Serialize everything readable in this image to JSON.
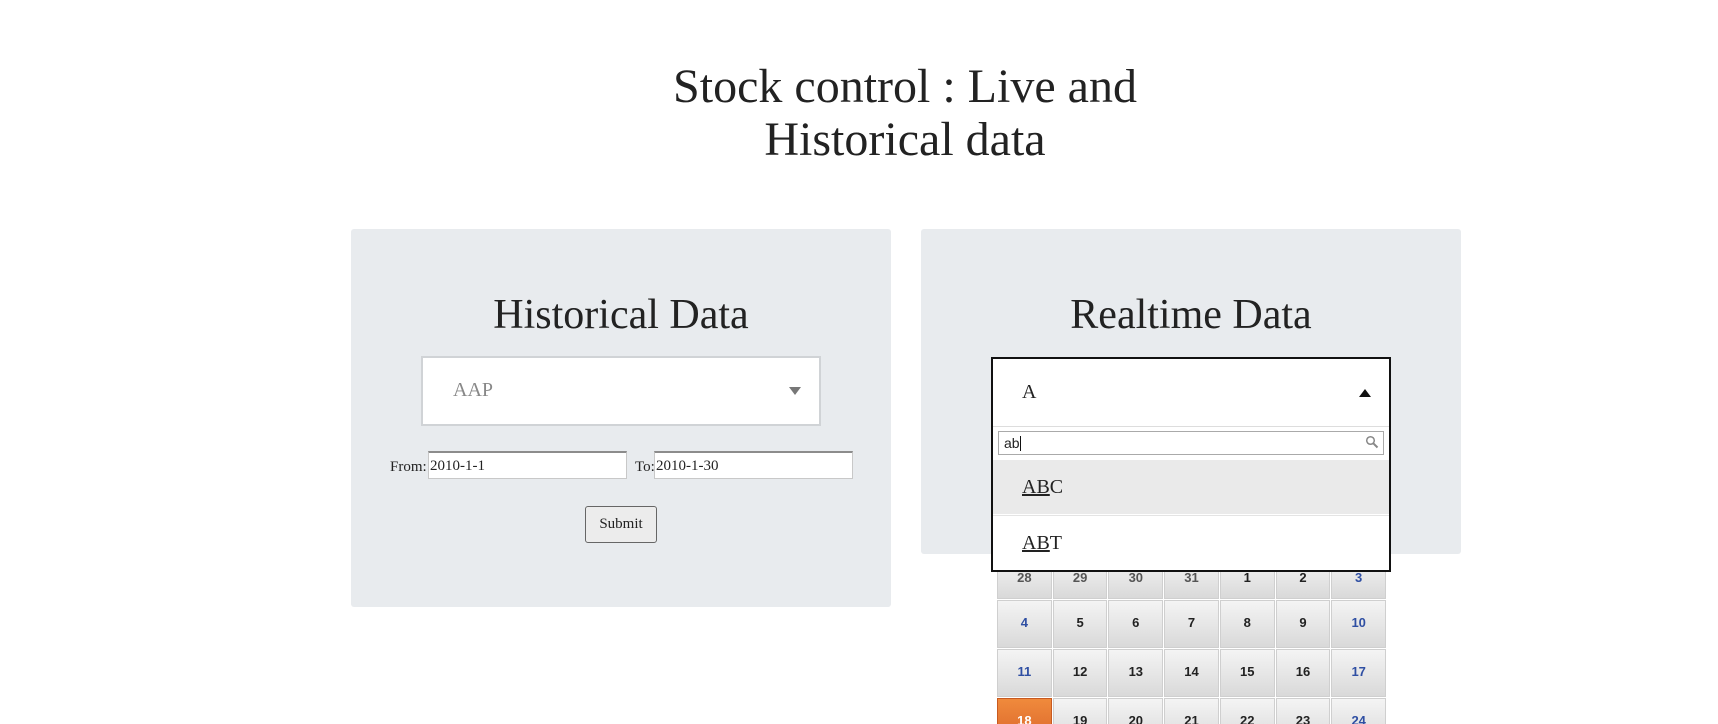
{
  "page": {
    "title_line1": "Stock control : Live and",
    "title_line2": "Historical data"
  },
  "historical": {
    "title": "Historical Data",
    "symbol_selected": "AAP",
    "from_label": "From:",
    "from_value": "2010-1-1",
    "to_label": "To:",
    "to_value": "2010-1-30",
    "submit_label": "Submit"
  },
  "realtime": {
    "title": "Realtime Data",
    "symbol_selected": "A",
    "search_value": "ab",
    "options": [
      {
        "match": "AB",
        "rest": "C",
        "highlighted": true
      },
      {
        "match": "AB",
        "rest": "T",
        "highlighted": false
      }
    ]
  },
  "calendar": {
    "today": "18",
    "weeks": [
      [
        "28",
        "29",
        "30",
        "31",
        "1",
        "2",
        "3"
      ],
      [
        "4",
        "5",
        "6",
        "7",
        "8",
        "9",
        "10"
      ],
      [
        "11",
        "12",
        "13",
        "14",
        "15",
        "16",
        "17"
      ],
      [
        "18",
        "19",
        "20",
        "21",
        "22",
        "23",
        "24"
      ]
    ]
  },
  "colors": {
    "panel_bg": "#e8ebee",
    "today_accent": "#e0702f",
    "weekend_text": "#2f4fa3"
  }
}
